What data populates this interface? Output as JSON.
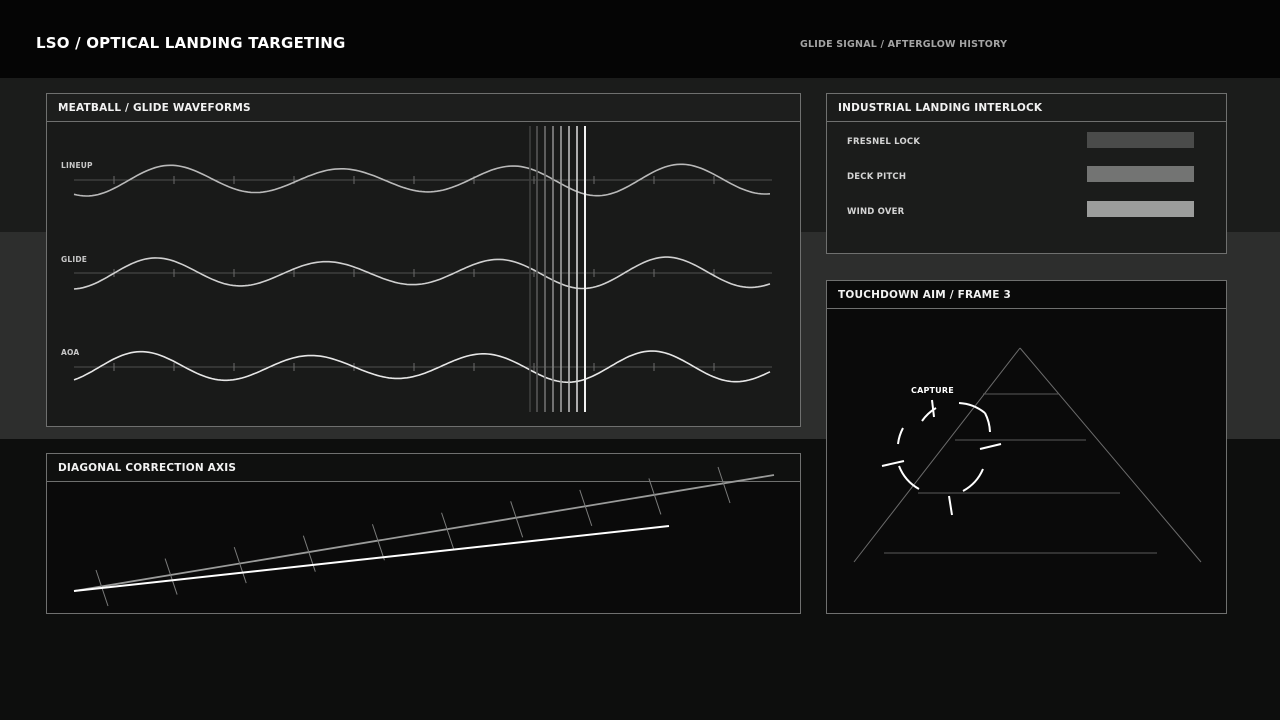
{
  "header": {
    "title": "LSO / OPTICAL LANDING TARGETING",
    "subtitle": "GLIDE SIGNAL / AFTERGLOW HISTORY"
  },
  "waveforms": {
    "title": "MEATBALL / GLIDE WAVEFORMS",
    "channels": [
      {
        "label": "LINEUP"
      },
      {
        "label": "GLIDE"
      },
      {
        "label": "AOA"
      }
    ]
  },
  "diagonal": {
    "title": "DIAGONAL CORRECTION AXIS"
  },
  "interlock": {
    "title": "INDUSTRIAL LANDING INTERLOCK",
    "rows": [
      {
        "label": "FRESNEL LOCK",
        "color": "#4a4b4a"
      },
      {
        "label": "DECK PITCH",
        "color": "#737473"
      },
      {
        "label": "WIND OVER",
        "color": "#9c9d9c"
      }
    ]
  },
  "aim": {
    "title": "TOUCHDOWN AIM / FRAME 3",
    "reticle_label": "CAPTURE"
  },
  "colors": {
    "background": "#0d0e0d",
    "panel_border": "#6f706f",
    "trace": "#d6d6d6",
    "reticle": "#ffffff"
  }
}
